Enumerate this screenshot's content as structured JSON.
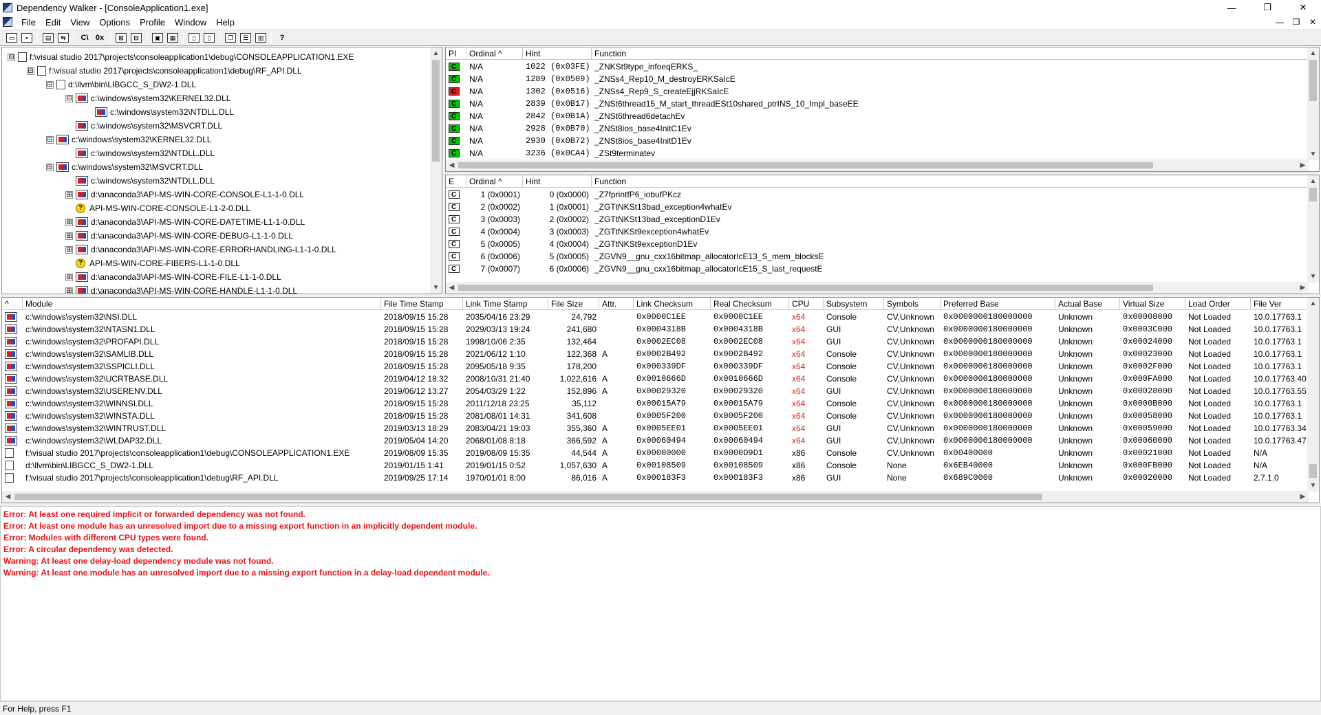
{
  "window": {
    "title": "Dependency Walker - [ConsoleApplication1.exe]",
    "minimize_glyph": "—",
    "maximize_glyph": "❐",
    "close_glyph": "✕",
    "child_minimize_glyph": "—",
    "child_restore_glyph": "❐",
    "child_close_glyph": "✕"
  },
  "menu": [
    "File",
    "Edit",
    "View",
    "Options",
    "Profile",
    "Window",
    "Help"
  ],
  "toolbar": {
    "cpp_label": "C\\",
    "hex_label": "0x",
    "help_label": "?"
  },
  "tree": [
    {
      "depth": 0,
      "expander": "⊟",
      "icon": "plain",
      "label": "f:\\visual studio 2017\\projects\\consoleapplication1\\debug\\CONSOLEAPPLICATION1.EXE"
    },
    {
      "depth": 1,
      "expander": "⊟",
      "icon": "plain",
      "label": "f:\\visual studio 2017\\projects\\consoleapplication1\\debug\\RF_API.DLL"
    },
    {
      "depth": 2,
      "expander": "⊟",
      "icon": "plain",
      "label": "d:\\llvm\\bin\\LIBGCC_S_DW2-1.DLL"
    },
    {
      "depth": 3,
      "expander": "⊟",
      "icon": "red-blue",
      "label": "c:\\windows\\system32\\KERNEL32.DLL"
    },
    {
      "depth": 4,
      "expander": "",
      "icon": "red-blue",
      "label": "c:\\windows\\system32\\NTDLL.DLL"
    },
    {
      "depth": 3,
      "expander": "",
      "icon": "red-blue",
      "label": "c:\\windows\\system32\\MSVCRT.DLL"
    },
    {
      "depth": 2,
      "expander": "⊟",
      "icon": "red-blue",
      "label": "c:\\windows\\system32\\KERNEL32.DLL"
    },
    {
      "depth": 3,
      "expander": "",
      "icon": "red-blue",
      "label": "c:\\windows\\system32\\NTDLL.DLL"
    },
    {
      "depth": 2,
      "expander": "⊟",
      "icon": "red-blue",
      "label": "c:\\windows\\system32\\MSVCRT.DLL"
    },
    {
      "depth": 3,
      "expander": "",
      "icon": "red-blue",
      "label": "c:\\windows\\system32\\NTDLL.DLL"
    },
    {
      "depth": 3,
      "expander": "⊞",
      "icon": "red-blue",
      "label": "d:\\anaconda3\\API-MS-WIN-CORE-CONSOLE-L1-1-0.DLL"
    },
    {
      "depth": 3,
      "expander": "",
      "icon": "warn",
      "label": "API-MS-WIN-CORE-CONSOLE-L1-2-0.DLL"
    },
    {
      "depth": 3,
      "expander": "⊞",
      "icon": "red-blue",
      "label": "d:\\anaconda3\\API-MS-WIN-CORE-DATETIME-L1-1-0.DLL"
    },
    {
      "depth": 3,
      "expander": "⊞",
      "icon": "red-blue",
      "label": "d:\\anaconda3\\API-MS-WIN-CORE-DEBUG-L1-1-0.DLL"
    },
    {
      "depth": 3,
      "expander": "⊞",
      "icon": "red-blue",
      "label": "d:\\anaconda3\\API-MS-WIN-CORE-ERRORHANDLING-L1-1-0.DLL"
    },
    {
      "depth": 3,
      "expander": "",
      "icon": "warn",
      "label": "API-MS-WIN-CORE-FIBERS-L1-1-0.DLL"
    },
    {
      "depth": 3,
      "expander": "⊞",
      "icon": "red-blue",
      "label": "d:\\anaconda3\\API-MS-WIN-CORE-FILE-L1-1-0.DLL"
    },
    {
      "depth": 3,
      "expander": "⊞",
      "icon": "red-blue",
      "label": "d:\\anaconda3\\API-MS-WIN-CORE-HANDLE-L1-1-0.DLL"
    }
  ],
  "imports": {
    "headers": [
      "PI",
      "Ordinal ^",
      "Hint",
      "Function"
    ],
    "rows": [
      {
        "status": "green",
        "ordinal": "N/A",
        "hint": "1022 (0x03FE)",
        "function": "_ZNKSt9type_infoeqERKS_"
      },
      {
        "status": "green",
        "ordinal": "N/A",
        "hint": "1289 (0x0509)",
        "function": "_ZNSs4_Rep10_M_destroyERKSaIcE"
      },
      {
        "status": "red",
        "ordinal": "N/A",
        "hint": "1302 (0x0516)",
        "function": "_ZNSs4_Rep9_S_createEjjRKSaIcE"
      },
      {
        "status": "green",
        "ordinal": "N/A",
        "hint": "2839 (0x0B17)",
        "function": "_ZNSt6thread15_M_start_threadESt10shared_ptrINS_10_Impl_baseEE"
      },
      {
        "status": "green",
        "ordinal": "N/A",
        "hint": "2842 (0x0B1A)",
        "function": "_ZNSt6thread6detachEv"
      },
      {
        "status": "green",
        "ordinal": "N/A",
        "hint": "2928 (0x0B70)",
        "function": "_ZNSt8ios_base4InitC1Ev"
      },
      {
        "status": "green",
        "ordinal": "N/A",
        "hint": "2930 (0x0B72)",
        "function": "_ZNSt8ios_base4InitD1Ev"
      },
      {
        "status": "green",
        "ordinal": "N/A",
        "hint": "3236 (0x0CA4)",
        "function": "_ZSt9terminatev"
      }
    ]
  },
  "exports": {
    "headers": [
      "E",
      "Ordinal ^",
      "Hint",
      "Function"
    ],
    "rows": [
      {
        "ordinal": "1 (0x0001)",
        "hint": "0 (0x0000)",
        "function": "_Z7fprintfP6_iobufPKcz"
      },
      {
        "ordinal": "2 (0x0002)",
        "hint": "1 (0x0001)",
        "function": "_ZGTtNKSt13bad_exception4whatEv"
      },
      {
        "ordinal": "3 (0x0003)",
        "hint": "2 (0x0002)",
        "function": "_ZGTtNKSt13bad_exceptionD1Ev"
      },
      {
        "ordinal": "4 (0x0004)",
        "hint": "3 (0x0003)",
        "function": "_ZGTtNKSt9exception4whatEv"
      },
      {
        "ordinal": "5 (0x0005)",
        "hint": "4 (0x0004)",
        "function": "_ZGTtNKSt9exceptionD1Ev"
      },
      {
        "ordinal": "6 (0x0006)",
        "hint": "5 (0x0005)",
        "function": "_ZGVN9__gnu_cxx16bitmap_allocatorIcE13_S_mem_blocksE"
      },
      {
        "ordinal": "7 (0x0007)",
        "hint": "6 (0x0006)",
        "function": "_ZGVN9__gnu_cxx16bitmap_allocatorIcE15_S_last_requestE"
      }
    ]
  },
  "modules": {
    "headers": [
      "^",
      "Module",
      "File Time Stamp",
      "Link Time Stamp",
      "File Size",
      "Attr.",
      "Link Checksum",
      "Real Checksum",
      "CPU",
      "Subsystem",
      "Symbols",
      "Preferred Base",
      "Actual Base",
      "Virtual Size",
      "Load Order",
      "File Ver"
    ],
    "rows": [
      {
        "icon": "red-blue",
        "module": "c:\\windows\\system32\\NSI.DLL",
        "file_ts": "2018/09/15 15:28",
        "link_ts": "2035/04/16 23:29",
        "size": "24,792",
        "attr": "",
        "link_ck": "0x0000C1EE",
        "real_ck": "0x0000C1EE",
        "cpu": "x64",
        "subsystem": "Console",
        "symbols": "CV,Unknown",
        "pref_base": "0x0000000180000000",
        "actual_base": "Unknown",
        "vsize": "0x00008000",
        "load_order": "Not Loaded",
        "file_ver": "10.0.17763.1"
      },
      {
        "icon": "red-blue",
        "module": "c:\\windows\\system32\\NTASN1.DLL",
        "file_ts": "2018/09/15 15:28",
        "link_ts": "2029/03/13 19:24",
        "size": "241,680",
        "attr": "",
        "link_ck": "0x0004318B",
        "real_ck": "0x0004318B",
        "cpu": "x64",
        "subsystem": "GUI",
        "symbols": "CV,Unknown",
        "pref_base": "0x0000000180000000",
        "actual_base": "Unknown",
        "vsize": "0x0003C000",
        "load_order": "Not Loaded",
        "file_ver": "10.0.17763.1"
      },
      {
        "icon": "red-blue",
        "module": "c:\\windows\\system32\\PROFAPI.DLL",
        "file_ts": "2018/09/15 15:28",
        "link_ts": "1998/10/06  2:35",
        "size": "132,464",
        "attr": "",
        "link_ck": "0x0002EC08",
        "real_ck": "0x0002EC08",
        "cpu": "x64",
        "subsystem": "GUI",
        "symbols": "CV,Unknown",
        "pref_base": "0x0000000180000000",
        "actual_base": "Unknown",
        "vsize": "0x00024000",
        "load_order": "Not Loaded",
        "file_ver": "10.0.17763.1"
      },
      {
        "icon": "red-blue",
        "module": "c:\\windows\\system32\\SAMLIB.DLL",
        "file_ts": "2018/09/15 15:28",
        "link_ts": "2021/06/12  1:10",
        "size": "122,368",
        "attr": "A",
        "link_ck": "0x0002B492",
        "real_ck": "0x0002B492",
        "cpu": "x64",
        "subsystem": "Console",
        "symbols": "CV,Unknown",
        "pref_base": "0x0000000180000000",
        "actual_base": "Unknown",
        "vsize": "0x00023000",
        "load_order": "Not Loaded",
        "file_ver": "10.0.17763.1"
      },
      {
        "icon": "red-blue",
        "module": "c:\\windows\\system32\\SSPICLI.DLL",
        "file_ts": "2018/09/15 15:28",
        "link_ts": "2095/05/18  9:35",
        "size": "178,200",
        "attr": "",
        "link_ck": "0x000339DF",
        "real_ck": "0x000339DF",
        "cpu": "x64",
        "subsystem": "Console",
        "symbols": "CV,Unknown",
        "pref_base": "0x0000000180000000",
        "actual_base": "Unknown",
        "vsize": "0x0002F000",
        "load_order": "Not Loaded",
        "file_ver": "10.0.17763.1"
      },
      {
        "icon": "red-blue",
        "module": "c:\\windows\\system32\\UCRTBASE.DLL",
        "file_ts": "2019/04/12 18:32",
        "link_ts": "2008/10/31 21:40",
        "size": "1,022,616",
        "attr": "A",
        "link_ck": "0x0010666D",
        "real_ck": "0x0010666D",
        "cpu": "x64",
        "subsystem": "Console",
        "symbols": "CV,Unknown",
        "pref_base": "0x0000000180000000",
        "actual_base": "Unknown",
        "vsize": "0x000FA000",
        "load_order": "Not Loaded",
        "file_ver": "10.0.17763.40"
      },
      {
        "icon": "red-blue",
        "module": "c:\\windows\\system32\\USERENV.DLL",
        "file_ts": "2019/06/12 13:27",
        "link_ts": "2054/03/29  1:22",
        "size": "152,896",
        "attr": "A",
        "link_ck": "0x00029320",
        "real_ck": "0x00029320",
        "cpu": "x64",
        "subsystem": "GUI",
        "symbols": "CV,Unknown",
        "pref_base": "0x0000000180000000",
        "actual_base": "Unknown",
        "vsize": "0x00028000",
        "load_order": "Not Loaded",
        "file_ver": "10.0.17763.55"
      },
      {
        "icon": "red-blue",
        "module": "c:\\windows\\system32\\WINNSI.DLL",
        "file_ts": "2018/09/15 15:28",
        "link_ts": "2011/12/18 23:25",
        "size": "35,112",
        "attr": "",
        "link_ck": "0x00015A79",
        "real_ck": "0x00015A79",
        "cpu": "x64",
        "subsystem": "Console",
        "symbols": "CV,Unknown",
        "pref_base": "0x0000000180000000",
        "actual_base": "Unknown",
        "vsize": "0x0000B000",
        "load_order": "Not Loaded",
        "file_ver": "10.0.17763.1"
      },
      {
        "icon": "red-blue",
        "module": "c:\\windows\\system32\\WINSTA.DLL",
        "file_ts": "2018/09/15 15:28",
        "link_ts": "2081/08/01 14:31",
        "size": "341,608",
        "attr": "",
        "link_ck": "0x0005F200",
        "real_ck": "0x0005F200",
        "cpu": "x64",
        "subsystem": "Console",
        "symbols": "CV,Unknown",
        "pref_base": "0x0000000180000000",
        "actual_base": "Unknown",
        "vsize": "0x00058000",
        "load_order": "Not Loaded",
        "file_ver": "10.0.17763.1"
      },
      {
        "icon": "red-blue",
        "module": "c:\\windows\\system32\\WINTRUST.DLL",
        "file_ts": "2019/03/13 18:29",
        "link_ts": "2083/04/21 19:03",
        "size": "355,360",
        "attr": "A",
        "link_ck": "0x0005EE01",
        "real_ck": "0x0005EE01",
        "cpu": "x64",
        "subsystem": "GUI",
        "symbols": "CV,Unknown",
        "pref_base": "0x0000000180000000",
        "actual_base": "Unknown",
        "vsize": "0x00059000",
        "load_order": "Not Loaded",
        "file_ver": "10.0.17763.34"
      },
      {
        "icon": "red-blue",
        "module": "c:\\windows\\system32\\WLDAP32.DLL",
        "file_ts": "2019/05/04 14:20",
        "link_ts": "2068/01/08  8:18",
        "size": "366,592",
        "attr": "A",
        "link_ck": "0x00060494",
        "real_ck": "0x00060494",
        "cpu": "x64",
        "subsystem": "GUI",
        "symbols": "CV,Unknown",
        "pref_base": "0x0000000180000000",
        "actual_base": "Unknown",
        "vsize": "0x00060000",
        "load_order": "Not Loaded",
        "file_ver": "10.0.17763.47"
      },
      {
        "icon": "plain",
        "module": "f:\\visual studio 2017\\projects\\consoleapplication1\\debug\\CONSOLEAPPLICATION1.EXE",
        "file_ts": "2019/08/09 15:35",
        "link_ts": "2019/08/09 15:35",
        "size": "44,544",
        "attr": "A",
        "link_ck": "0x00000000",
        "real_ck": "0x0000D9D1",
        "cpu": "x86",
        "subsystem": "Console",
        "symbols": "CV,Unknown",
        "pref_base": "0x00400000",
        "actual_base": "Unknown",
        "vsize": "0x00021000",
        "load_order": "Not Loaded",
        "file_ver": "N/A"
      },
      {
        "icon": "plain",
        "module": "d:\\llvm\\bin\\LIBGCC_S_DW2-1.DLL",
        "file_ts": "2019/01/15  1:41",
        "link_ts": "2019/01/15  0:52",
        "size": "1,057,630",
        "attr": "A",
        "link_ck": "0x00108509",
        "real_ck": "0x00108509",
        "cpu": "x86",
        "subsystem": "Console",
        "symbols": "None",
        "pref_base": "0x6EB40000",
        "actual_base": "Unknown",
        "vsize": "0x000FB000",
        "load_order": "Not Loaded",
        "file_ver": "N/A"
      },
      {
        "icon": "plain",
        "module": "f:\\visual studio 2017\\projects\\consoleapplication1\\debug\\RF_API.DLL",
        "file_ts": "2019/09/25 17:14",
        "link_ts": "1970/01/01  8:00",
        "size": "86,016",
        "attr": "A",
        "link_ck": "0x000183F3",
        "real_ck": "0x000183F3",
        "cpu": "x86",
        "subsystem": "GUI",
        "symbols": "None",
        "pref_base": "0x689C0000",
        "actual_base": "Unknown",
        "vsize": "0x00020000",
        "load_order": "Not Loaded",
        "file_ver": "2.7.1.0"
      }
    ]
  },
  "log": [
    "Error: At least one required implicit or forwarded dependency was not found.",
    "Error: At least one module has an unresolved import due to a missing export function in an implicitly dependent module.",
    "Error: Modules with different CPU types were found.",
    "Error: A circular dependency was detected.",
    "Warning: At least one delay-load dependency module was not found.",
    "Warning: At least one module has an unresolved import due to a missing export function in a delay-load dependent module."
  ],
  "status": "For Help, press F1"
}
